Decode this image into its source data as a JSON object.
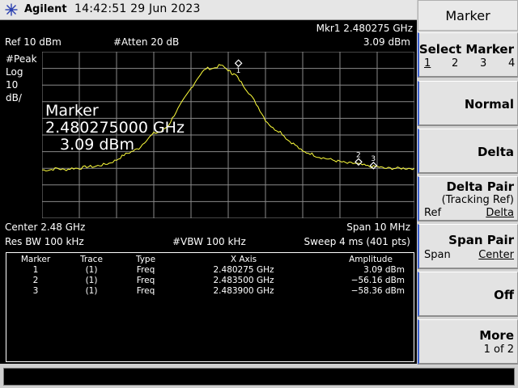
{
  "header": {
    "brand": "Agilent",
    "clock": "14:42:51  29 Jun 2023",
    "logo_icon": "agilent-spark-icon"
  },
  "screen": {
    "marker_readout": "Mkr1  2.480275 GHz",
    "marker_readout_amp": "3.09 dBm",
    "ref_level": "Ref 10 dBm",
    "atten": "#Atten 20 dB",
    "scale": [
      "#Peak",
      "Log",
      "10",
      "dB/"
    ],
    "big_marker": {
      "title": "Marker",
      "freq": "2.480275000 GHz",
      "amp": "3.09 dBm"
    },
    "center_freq": "Center 2.48 GHz",
    "span": "Span 10 MHz",
    "res_bw": "Res BW 100 kHz",
    "vbw": "#VBW 100 kHz",
    "sweep": "Sweep 4 ms (401 pts)"
  },
  "trace": {
    "color": "#ffff3c",
    "ref_dbm": 10,
    "db_per_div": 10,
    "center_ghz": 2.48,
    "span_mhz": 10,
    "points": [
      [
        -5.0,
        -61
      ],
      [
        -4.8,
        -61
      ],
      [
        -4.6,
        -60
      ],
      [
        -4.4,
        -61
      ],
      [
        -4.2,
        -60
      ],
      [
        -4.0,
        -60
      ],
      [
        -3.8,
        -59
      ],
      [
        -3.6,
        -59
      ],
      [
        -3.4,
        -58
      ],
      [
        -3.2,
        -57
      ],
      [
        -3.0,
        -55
      ],
      [
        -2.8,
        -52
      ],
      [
        -2.6,
        -50
      ],
      [
        -2.4,
        -48
      ],
      [
        -2.2,
        -43
      ],
      [
        -2.0,
        -39
      ],
      [
        -1.8,
        -38
      ],
      [
        -1.6,
        -34
      ],
      [
        -1.4,
        -26
      ],
      [
        -1.2,
        -19
      ],
      [
        -1.0,
        -12
      ],
      [
        -0.8,
        -5
      ],
      [
        -0.6,
        0
      ],
      [
        -0.4,
        0
      ],
      [
        -0.2,
        2
      ],
      [
        0.0,
        -1
      ],
      [
        0.1,
        -3
      ],
      [
        0.2,
        -4
      ],
      [
        0.4,
        -10
      ],
      [
        0.6,
        -16
      ],
      [
        0.8,
        -23
      ],
      [
        1.0,
        -31
      ],
      [
        1.2,
        -36
      ],
      [
        1.4,
        -38
      ],
      [
        1.6,
        -43
      ],
      [
        1.8,
        -46
      ],
      [
        2.0,
        -50
      ],
      [
        2.2,
        -51
      ],
      [
        2.4,
        -53
      ],
      [
        2.6,
        -54
      ],
      [
        2.8,
        -55
      ],
      [
        3.0,
        -56
      ],
      [
        3.2,
        -57
      ],
      [
        3.4,
        -57
      ],
      [
        3.6,
        -58
      ],
      [
        3.8,
        -59
      ],
      [
        4.0,
        -59
      ],
      [
        4.2,
        -60
      ],
      [
        4.4,
        -60
      ],
      [
        4.6,
        -60
      ],
      [
        4.8,
        -60
      ],
      [
        5.0,
        -60
      ]
    ]
  },
  "markers_on_trace": [
    {
      "label": "1",
      "offset_mhz": 0.275,
      "amp_dbm": 3.09
    },
    {
      "label": "2",
      "offset_mhz": 3.5,
      "amp_dbm": -56.16
    },
    {
      "label": "3",
      "offset_mhz": 3.9,
      "amp_dbm": -58.36
    }
  ],
  "marker_table": {
    "headers": [
      "Marker",
      "Trace",
      "Type",
      "X Axis",
      "Amplitude"
    ],
    "rows": [
      [
        "1",
        "(1)",
        "Freq",
        "2.480275 GHz",
        "3.09 dBm"
      ],
      [
        "2",
        "(1)",
        "Freq",
        "2.483500 GHz",
        "−56.16 dBm"
      ],
      [
        "3",
        "(1)",
        "Freq",
        "2.483900 GHz",
        "−58.36 dBm"
      ]
    ]
  },
  "softkeys": {
    "title": "Marker",
    "select_marker": {
      "label": "Select Marker",
      "options": [
        "1",
        "2",
        "3",
        "4"
      ]
    },
    "normal": "Normal",
    "delta": "Delta",
    "delta_pair": {
      "label": "Delta Pair",
      "sub": "(Tracking Ref)",
      "left": "Ref",
      "right": "Delta"
    },
    "span_pair": {
      "label": "Span Pair",
      "left": "Span",
      "right": "Center"
    },
    "off": "Off",
    "more": {
      "label": "More",
      "sub": "1 of 2"
    }
  }
}
